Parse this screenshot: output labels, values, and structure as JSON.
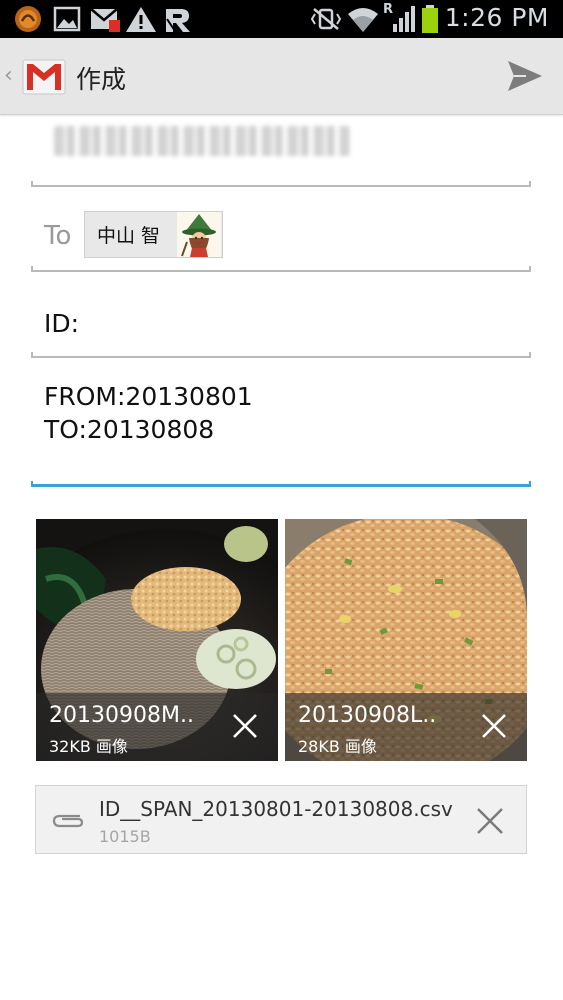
{
  "status_bar": {
    "time": "1:26 PM",
    "network_label": "R",
    "icons": [
      "browser-icon",
      "image-icon",
      "gmail-notification-icon",
      "warning-icon",
      "r-app-icon",
      "vibrate-off-icon",
      "wifi-icon",
      "signal-icon",
      "battery-icon"
    ]
  },
  "action_bar": {
    "title": "作成",
    "send_icon": "send-icon"
  },
  "compose": {
    "to_label": "To",
    "recipient_name": "中山 智",
    "subject": "ID:",
    "body_lines": [
      "FROM:20130801",
      "TO:20130808"
    ]
  },
  "attachments": [
    {
      "name": "20130908M..",
      "meta": "32KB 画像"
    },
    {
      "name": "20130908L..",
      "meta": "28KB 画像"
    }
  ],
  "file_attachment": {
    "name": "ID__SPAN_20130801-20130808.csv",
    "size": "1015B"
  },
  "colors": {
    "accent_blue": "#33a3d8",
    "action_bar": "#e6e6e6",
    "gmail_red": "#d93025",
    "battery_green": "#9bd20c"
  }
}
